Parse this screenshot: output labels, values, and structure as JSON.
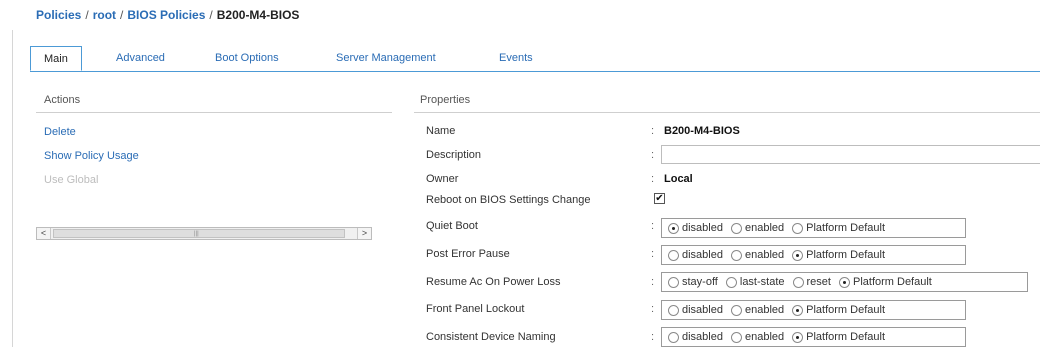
{
  "breadcrumb": {
    "policies": "Policies",
    "root": "root",
    "bios_policies": "BIOS Policies",
    "current": "B200-M4-BIOS",
    "separator": "/"
  },
  "tabs": [
    {
      "label": "Main",
      "active": true
    },
    {
      "label": "Advanced",
      "active": false
    },
    {
      "label": "Boot Options",
      "active": false
    },
    {
      "label": "Server Management",
      "active": false
    },
    {
      "label": "Events",
      "active": false
    }
  ],
  "actions": {
    "title": "Actions",
    "delete": "Delete",
    "show_policy_usage": "Show Policy Usage",
    "use_global": "Use Global"
  },
  "scrollbar": {
    "left_arrow": "<",
    "right_arrow": ">",
    "grip": "|||"
  },
  "properties": {
    "title": "Properties",
    "colon": ":",
    "name": {
      "label": "Name",
      "value": "B200-M4-BIOS"
    },
    "description": {
      "label": "Description",
      "value": ""
    },
    "owner": {
      "label": "Owner",
      "value": "Local"
    },
    "reboot": {
      "label": "Reboot on BIOS Settings Change",
      "checked": true,
      "check_mark": "✔"
    },
    "quiet_boot": {
      "label": "Quiet Boot",
      "options": [
        "disabled",
        "enabled",
        "Platform Default"
      ],
      "selected": "disabled"
    },
    "post_error_pause": {
      "label": "Post Error Pause",
      "options": [
        "disabled",
        "enabled",
        "Platform Default"
      ],
      "selected": "Platform Default"
    },
    "resume_ac": {
      "label": "Resume Ac On Power Loss",
      "options": [
        "stay-off",
        "last-state",
        "reset",
        "Platform Default"
      ],
      "selected": "Platform Default"
    },
    "front_panel_lockout": {
      "label": "Front Panel Lockout",
      "options": [
        "disabled",
        "enabled",
        "Platform Default"
      ],
      "selected": "Platform Default"
    },
    "consistent_device_naming": {
      "label": "Consistent Device Naming",
      "options": [
        "disabled",
        "enabled",
        "Platform Default"
      ],
      "selected": "Platform Default"
    }
  },
  "colors": {
    "link": "#2a6cb5",
    "tab_border": "#4c9ad6",
    "disabled_text": "#bdbdbd"
  }
}
